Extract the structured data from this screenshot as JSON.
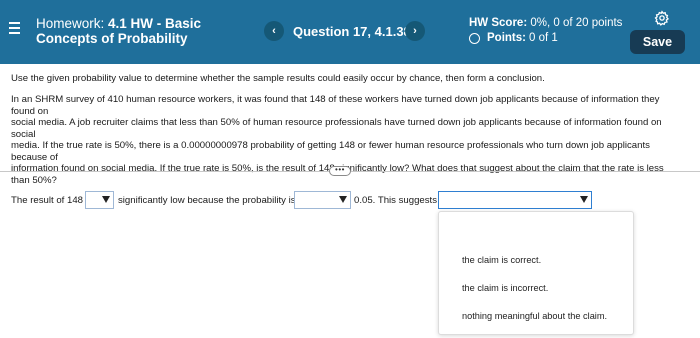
{
  "header": {
    "title_prefix": "Homework: ",
    "title_bold_line1": "4.1 HW - Basic",
    "title_bold_line2": "Concepts of Probability",
    "question_label": "Question 17, 4.1.38",
    "prev_glyph": "‹",
    "next_glyph": "›",
    "hw_score_label": "HW Score:",
    "hw_score_value": " 0%, 0 of 20 points",
    "points_label": "Points:",
    "points_value": "0 of 1",
    "save_label": "Save",
    "icons": [
      "menu-icon",
      "chevron-left-icon",
      "chevron-right-icon",
      "radio-circle-icon",
      "gear-icon"
    ],
    "colors": {
      "header_bg": "#1f6f9b",
      "save_bg": "#173b54"
    }
  },
  "content": {
    "instruction": "Use the given probability value to determine whether the sample results could easily occur by chance, then form a conclusion.",
    "question_lines": [
      "In an SHRM survey of 410 human resource workers, it was found that 148 of these workers have turned down job applicants because of information they found on",
      "social media. A job recruiter claims that less than 50% of human resource professionals have turned down job applicants because of information found on social",
      "media. If the true rate is 50%, there is a 0.00000000978 probability of getting 148 or fewer human resource professionals who turn down job applicants because of",
      "information found on social media. If the true rate is 50%, is the result of 148 significantly low? What does that suggest about the claim that the rate is less",
      "than 50%?"
    ],
    "more_handle": "•••"
  },
  "answer": {
    "part1": "The result of 148",
    "part2": "significantly low because the probability is",
    "part3": "0.05. This suggests",
    "select1_value": "",
    "select2_value": "",
    "select3_value": ""
  },
  "dropdown": {
    "options": [
      "the claim is correct.",
      "the claim is incorrect.",
      "nothing meaningful about the claim."
    ]
  }
}
